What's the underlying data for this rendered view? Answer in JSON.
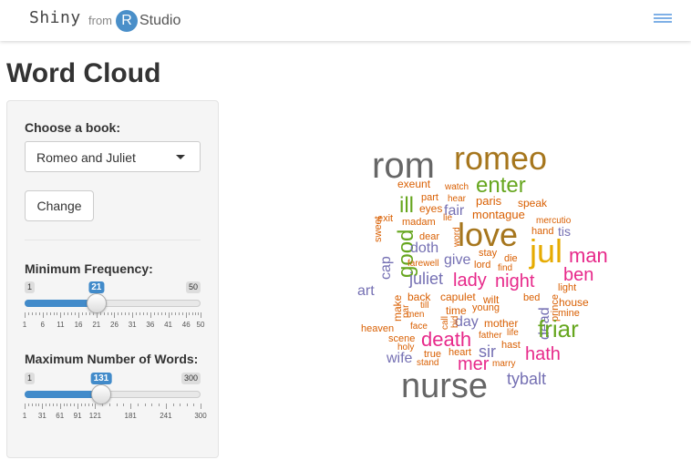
{
  "navbar": {
    "brand_shiny": "Shiny",
    "brand_from": "from",
    "brand_r": "R",
    "brand_studio": "Studio"
  },
  "page": {
    "title": "Word Cloud"
  },
  "sidebar": {
    "book_label": "Choose a book:",
    "book_selected": "Romeo and Juliet",
    "change_button": "Change",
    "min_freq": {
      "label": "Minimum Frequency:",
      "min": "1",
      "max": "50",
      "value": "21",
      "fraction": 0.4082,
      "ticks": [
        "1",
        "6",
        "11",
        "16",
        "21",
        "26",
        "31",
        "36",
        "41",
        "46",
        "50"
      ]
    },
    "max_words": {
      "label": "Maximum Number of Words:",
      "min": "1",
      "max": "300",
      "value": "131",
      "fraction": 0.4348,
      "ticks": [
        "1",
        "31",
        "61",
        "91",
        "121",
        "181",
        "241",
        "300"
      ]
    }
  },
  "colors": {
    "accent": "#428bca",
    "word_orange": "#d95f02",
    "word_olive": "#a6761d",
    "word_gray": "#666666",
    "word_green": "#66a61e",
    "word_pink": "#e7298a",
    "word_purple": "#7570b3",
    "word_gold": "#e6ab02"
  },
  "word_cloud": {
    "words": [
      {
        "text": "rom",
        "color": "#666666"
      },
      {
        "text": "romeo",
        "color": "#a6761d"
      },
      {
        "text": "enter",
        "color": "#66a61e"
      },
      {
        "text": "exeunt",
        "color": "#d95f02"
      },
      {
        "text": "watch",
        "color": "#d95f02"
      },
      {
        "text": "part",
        "color": "#d95f02"
      },
      {
        "text": "hear",
        "color": "#d95f02"
      },
      {
        "text": "paris",
        "color": "#d95f02"
      },
      {
        "text": "speak",
        "color": "#d95f02"
      },
      {
        "text": "ill",
        "color": "#66a61e"
      },
      {
        "text": "eyes",
        "color": "#d95f02"
      },
      {
        "text": "fair",
        "color": "#7570b3"
      },
      {
        "text": "montague",
        "color": "#d95f02"
      },
      {
        "text": "sweet",
        "color": "#d95f02"
      },
      {
        "text": "exit",
        "color": "#d95f02"
      },
      {
        "text": "madam",
        "color": "#d95f02"
      },
      {
        "text": "lie",
        "color": "#d95f02"
      },
      {
        "text": "mercutio",
        "color": "#d95f02"
      },
      {
        "text": "hand",
        "color": "#d95f02"
      },
      {
        "text": "tis",
        "color": "#7570b3"
      },
      {
        "text": "word",
        "color": "#d95f02"
      },
      {
        "text": "love",
        "color": "#a6761d"
      },
      {
        "text": "dear",
        "color": "#d95f02"
      },
      {
        "text": "good",
        "color": "#66a61e"
      },
      {
        "text": "doth",
        "color": "#7570b3"
      },
      {
        "text": "jul",
        "color": "#e6ab02"
      },
      {
        "text": "man",
        "color": "#e7298a"
      },
      {
        "text": "stay",
        "color": "#d95f02"
      },
      {
        "text": "cap",
        "color": "#7570b3"
      },
      {
        "text": "farewell",
        "color": "#d95f02"
      },
      {
        "text": "give",
        "color": "#7570b3"
      },
      {
        "text": "die",
        "color": "#d95f02"
      },
      {
        "text": "lord",
        "color": "#d95f02"
      },
      {
        "text": "find",
        "color": "#d95f02"
      },
      {
        "text": "ben",
        "color": "#e7298a"
      },
      {
        "text": "juliet",
        "color": "#7570b3"
      },
      {
        "text": "lady",
        "color": "#e7298a"
      },
      {
        "text": "night",
        "color": "#e7298a"
      },
      {
        "text": "light",
        "color": "#d95f02"
      },
      {
        "text": "art",
        "color": "#7570b3"
      },
      {
        "text": "make",
        "color": "#d95f02"
      },
      {
        "text": "back",
        "color": "#d95f02"
      },
      {
        "text": "capulet",
        "color": "#d95f02"
      },
      {
        "text": "wilt",
        "color": "#d95f02"
      },
      {
        "text": "bed",
        "color": "#d95f02"
      },
      {
        "text": "prince",
        "color": "#d95f02"
      },
      {
        "text": "house",
        "color": "#d95f02"
      },
      {
        "text": "par",
        "color": "#d95f02"
      },
      {
        "text": "till",
        "color": "#d95f02"
      },
      {
        "text": "young",
        "color": "#d95f02"
      },
      {
        "text": "men",
        "color": "#d95f02"
      },
      {
        "text": "time",
        "color": "#d95f02"
      },
      {
        "text": "dead",
        "color": "#7570b3"
      },
      {
        "text": "mine",
        "color": "#d95f02"
      },
      {
        "text": "call",
        "color": "#d95f02"
      },
      {
        "text": "day",
        "color": "#7570b3"
      },
      {
        "text": "face",
        "color": "#d95f02"
      },
      {
        "text": "bid",
        "color": "#d95f02"
      },
      {
        "text": "mother",
        "color": "#d95f02"
      },
      {
        "text": "friar",
        "color": "#66a61e"
      },
      {
        "text": "heaven",
        "color": "#d95f02"
      },
      {
        "text": "scene",
        "color": "#d95f02"
      },
      {
        "text": "death",
        "color": "#e7298a"
      },
      {
        "text": "life",
        "color": "#d95f02"
      },
      {
        "text": "father",
        "color": "#d95f02"
      },
      {
        "text": "holy",
        "color": "#d95f02"
      },
      {
        "text": "hast",
        "color": "#d95f02"
      },
      {
        "text": "true",
        "color": "#d95f02"
      },
      {
        "text": "sir",
        "color": "#7570b3"
      },
      {
        "text": "heart",
        "color": "#d95f02"
      },
      {
        "text": "hath",
        "color": "#e7298a"
      },
      {
        "text": "wife",
        "color": "#7570b3"
      },
      {
        "text": "stand",
        "color": "#d95f02"
      },
      {
        "text": "mer",
        "color": "#e7298a"
      },
      {
        "text": "marry",
        "color": "#d95f02"
      },
      {
        "text": "tybalt",
        "color": "#7570b3"
      },
      {
        "text": "nurse",
        "color": "#666666"
      }
    ]
  }
}
